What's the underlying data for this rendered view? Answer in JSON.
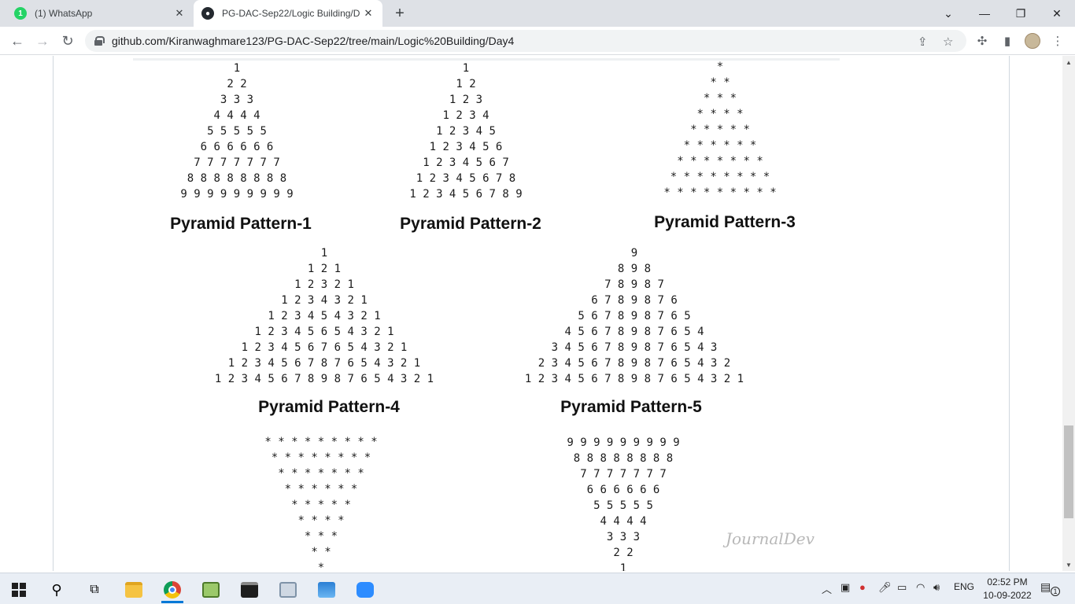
{
  "browser": {
    "tabs": [
      {
        "title": "(1) WhatsApp",
        "badge": "1"
      },
      {
        "title": "PG-DAC-Sep22/Logic Building/D"
      }
    ],
    "url": "github.com/Kiranwaghmare123/PG-DAC-Sep22/tree/main/Logic%20Building/Day4"
  },
  "patterns": {
    "p1": {
      "title": "Pyramid Pattern-1",
      "lines": [
        "1",
        "2 2",
        "3 3 3",
        "4 4 4 4",
        "5 5 5 5 5",
        "6 6 6 6 6 6",
        "7 7 7 7 7 7 7",
        "8 8 8 8 8 8 8 8",
        "9 9 9 9 9 9 9 9 9"
      ]
    },
    "p2": {
      "title": "Pyramid Pattern-2",
      "lines": [
        "1",
        "1 2",
        "1 2 3",
        "1 2 3 4",
        "1 2 3 4 5",
        "1 2 3 4 5 6",
        "1 2 3 4 5 6 7",
        "1 2 3 4 5 6 7 8",
        "1 2 3 4 5 6 7 8 9"
      ]
    },
    "p3": {
      "title": "Pyramid Pattern-3",
      "lines": [
        "*",
        "* *",
        "* * *",
        "* * * *",
        "* * * * *",
        "* * * * * *",
        "* * * * * * *",
        "* * * * * * * *",
        "* * * * * * * * *"
      ]
    },
    "p4": {
      "title": "Pyramid Pattern-4",
      "lines": [
        "1",
        "1 2 1",
        "1 2 3 2 1",
        "1 2 3 4 3 2 1",
        "1 2 3 4 5 4 3 2 1",
        "1 2 3 4 5 6 5 4 3 2 1",
        "1 2 3 4 5 6 7 6 5 4 3 2 1",
        "1 2 3 4 5 6 7 8 7 6 5 4 3 2 1",
        "1 2 3 4 5 6 7 8 9 8 7 6 5 4 3 2 1"
      ]
    },
    "p5": {
      "title": "Pyramid Pattern-5",
      "lines": [
        "9",
        "8 9 8",
        "7 8 9 8 7",
        "6 7 8 9 8 7 6",
        "5 6 7 8 9 8 7 6 5",
        "4 5 6 7 8 9 8 7 6 5 4",
        "3 4 5 6 7 8 9 8 7 6 5 4 3",
        "2 3 4 5 6 7 8 9 8 7 6 5 4 3 2",
        "1 2 3 4 5 6 7 8 9 8 7 6 5 4 3 2 1"
      ]
    },
    "p6": {
      "lines": [
        "* * * * * * * * *",
        "* * * * * * * *",
        "* * * * * * *",
        "* * * * * *",
        "* * * * *",
        "* * * *",
        "* * *",
        "* *",
        "*"
      ]
    },
    "p7": {
      "lines": [
        "9 9 9 9 9 9 9 9 9",
        "8 8 8 8 8 8 8 8",
        "7 7 7 7 7 7 7",
        "6 6 6 6 6 6",
        "5 5 5 5 5",
        "4 4 4 4",
        "3 3 3",
        "2 2",
        "1"
      ]
    }
  },
  "watermark": "JournalDev",
  "taskbar": {
    "apps": [
      "start-icon",
      "search-icon",
      "task-view-icon",
      "file-explorer-icon",
      "chrome-icon",
      "notepad-icon",
      "terminal-icon",
      "image-viewer-icon",
      "photos-icon",
      "zoom-icon"
    ],
    "lang": "ENG",
    "time": "02:52 PM",
    "date": "10-09-2022",
    "notif_count": "1"
  }
}
